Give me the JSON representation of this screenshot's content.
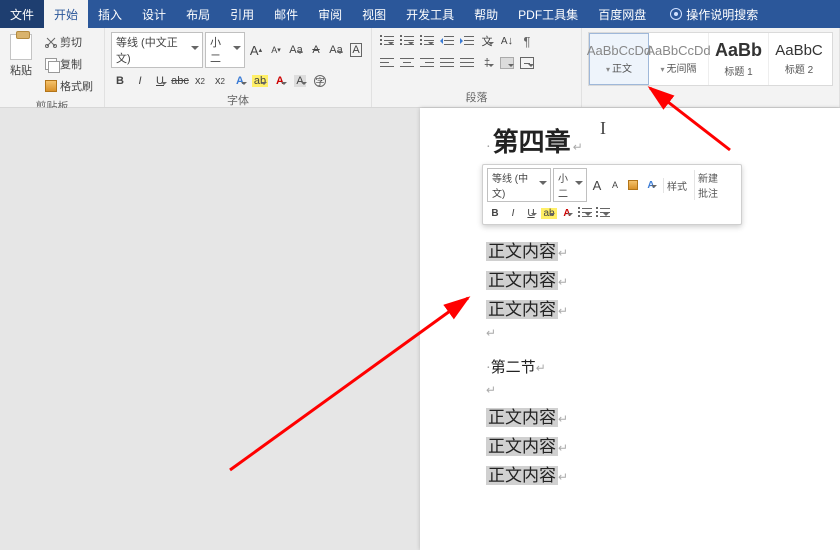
{
  "tabs": {
    "file": "文件",
    "home": "开始",
    "insert": "插入",
    "design": "设计",
    "layout": "布局",
    "references": "引用",
    "mailings": "邮件",
    "review": "审阅",
    "view": "视图",
    "developer": "开发工具",
    "help": "帮助",
    "pdf": "PDF工具集",
    "baidu": "百度网盘",
    "tellme": "操作说明搜索"
  },
  "clipboard": {
    "paste": "粘贴",
    "cut": "剪切",
    "copy": "复制",
    "format_painter": "格式刷",
    "group_label": "剪贴板"
  },
  "font": {
    "name_value": "等线 (中文正文)",
    "size_value": "小二",
    "bold": "B",
    "italic": "I",
    "underline": "U",
    "strike": "abc",
    "sub": "x",
    "sup": "x",
    "increase": "A",
    "decrease": "A",
    "clear": "A",
    "phonetic": "Aa",
    "charborder": "A",
    "case": "Aa",
    "highlight": "ab",
    "color": "A",
    "ring": "A",
    "group_label": "字体"
  },
  "para": {
    "group_label": "段落",
    "az": "A",
    "sort": "↓",
    "pilcrow": "¶"
  },
  "styles": {
    "normal_preview": "AaBbCcDd",
    "normal_name": "正文",
    "nospace_preview": "AaBbCcDd",
    "nospace_name": "无间隔",
    "h1_preview": "AaBb",
    "h1_name": "标题 1",
    "h2_preview": "AaBbC",
    "h2_name": "标题 2"
  },
  "mini": {
    "font_name": "等线 (中文)",
    "font_size": "小二",
    "styles_label": "样式",
    "comment_label1": "新建",
    "comment_label2": "批注"
  },
  "doc": {
    "heading": "第四章",
    "ret_glyph": "↵",
    "body1": "正文内容",
    "body2": "正文内容",
    "body3": "正文内容",
    "subheading": "第二节",
    "body4": "正文内容",
    "body5": "正文内容",
    "body6": "正文内容"
  },
  "cursor_glyph": "I"
}
